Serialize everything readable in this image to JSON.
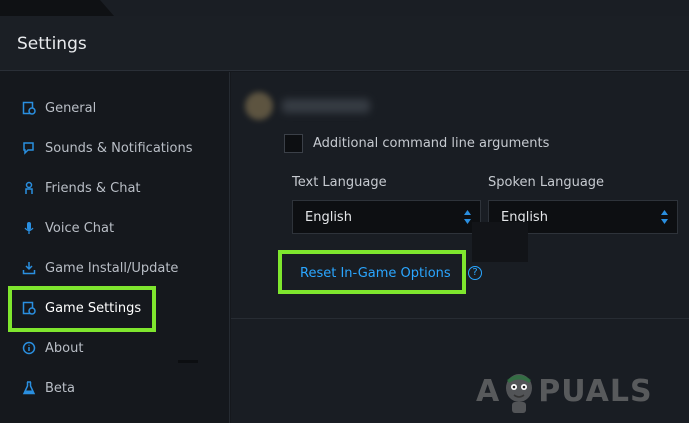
{
  "header": {
    "title": "Settings"
  },
  "sidebar": {
    "items": [
      {
        "label": "General",
        "icon": "general-settings-icon"
      },
      {
        "label": "Sounds & Notifications",
        "icon": "bell-icon"
      },
      {
        "label": "Friends & Chat",
        "icon": "person-icon"
      },
      {
        "label": "Voice Chat",
        "icon": "microphone-icon"
      },
      {
        "label": "Game Install/Update",
        "icon": "download-icon"
      },
      {
        "label": "Game Settings",
        "icon": "game-settings-icon",
        "active": true
      },
      {
        "label": "About",
        "icon": "info-icon"
      },
      {
        "label": "Beta",
        "icon": "flask-icon"
      }
    ]
  },
  "main": {
    "checkbox": {
      "label": "Additional command line arguments",
      "checked": false
    },
    "text_language": {
      "label": "Text Language",
      "value": "English"
    },
    "spoken_language": {
      "label": "Spoken Language",
      "value": "English"
    },
    "reset_link": "Reset In-Game Options",
    "help_glyph": "?"
  },
  "watermark": {
    "left": "A",
    "right": "PUALS"
  },
  "colors": {
    "accent": "#2aa6ff",
    "highlight": "#7fe62e",
    "icon": "#2a8fe0"
  }
}
